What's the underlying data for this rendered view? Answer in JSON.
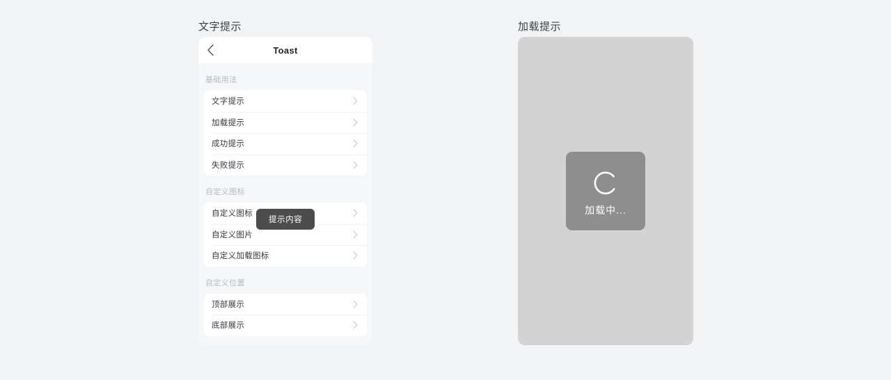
{
  "page": {
    "background_color": "#f2f3f5"
  },
  "panels": [
    {
      "caption": "文字提示",
      "phone": {
        "nav": {
          "back_icon": "chevron-left-icon",
          "title": "Toast"
        },
        "groups": [
          {
            "title": "基础用法",
            "items": [
              {
                "label": "文字提示",
                "accessory": "chevron-right-icon"
              },
              {
                "label": "加载提示",
                "accessory": "chevron-right-icon"
              },
              {
                "label": "成功提示",
                "accessory": "chevron-right-icon"
              },
              {
                "label": "失败提示",
                "accessory": "chevron-right-icon"
              }
            ]
          },
          {
            "title": "自定义图标",
            "items": [
              {
                "label": "自定义图标",
                "accessory": "chevron-right-icon"
              },
              {
                "label": "自定义图片",
                "accessory": "chevron-right-icon"
              },
              {
                "label": "自定义加载图标",
                "accessory": "chevron-right-icon"
              }
            ]
          },
          {
            "title": "自定义位置",
            "items": [
              {
                "label": "顶部展示",
                "accessory": "chevron-right-icon"
              },
              {
                "label": "底部展示",
                "accessory": "chevron-right-icon"
              }
            ]
          }
        ],
        "toast": {
          "text": "提示内容",
          "background_color": "#4c4c4c",
          "text_color": "#ffffff"
        }
      }
    },
    {
      "caption": "加载提示",
      "mask": {
        "background_color": "#d3d3d3"
      },
      "toast": {
        "icon": "loading-spinner-icon",
        "text": "加载中...",
        "background_color": "#8e8e8e",
        "text_color": "#ffffff"
      }
    }
  ]
}
